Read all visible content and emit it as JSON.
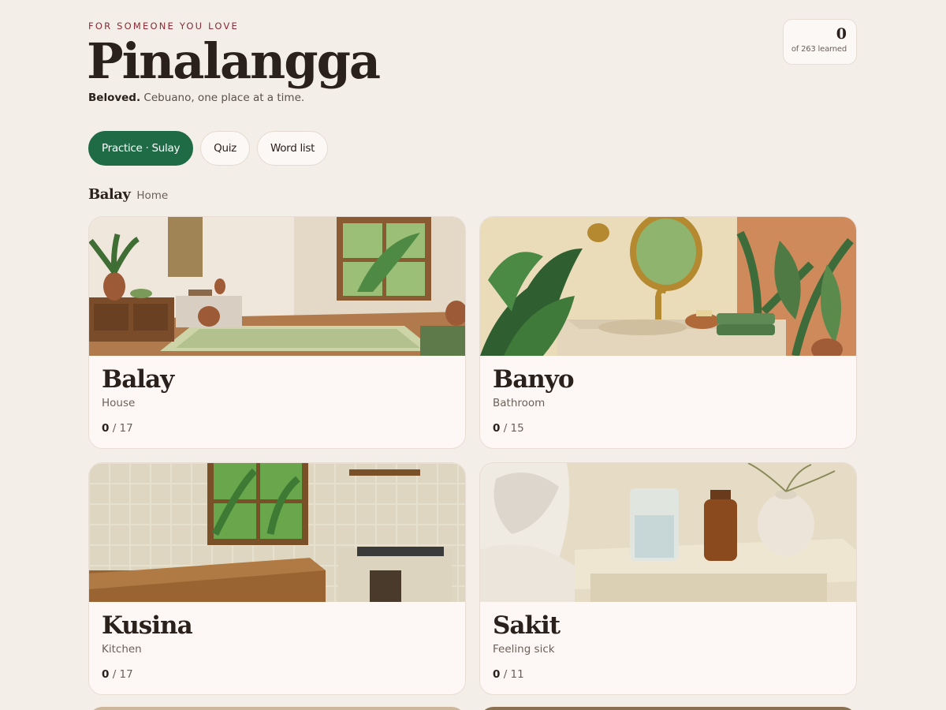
{
  "header": {
    "eyebrow": "FOR SOMEONE YOU LOVE",
    "title": "Pinalangga",
    "tagline_bold": "Beloved.",
    "tagline_rest": " Cebuano, one place at a time."
  },
  "progress": {
    "count": "0",
    "label": "of 263 learned"
  },
  "tabs": [
    {
      "label": "Practice · Sulay",
      "active": true
    },
    {
      "label": "Quiz",
      "active": false
    },
    {
      "label": "Word list",
      "active": false
    }
  ],
  "section": {
    "title": "Balay",
    "subtitle": "Home"
  },
  "cards": [
    {
      "name": "Balay",
      "english": "House",
      "learned": "0",
      "total": "/ 17",
      "scene": "living-room"
    },
    {
      "name": "Banyo",
      "english": "Bathroom",
      "learned": "0",
      "total": "/ 15",
      "scene": "bathroom"
    },
    {
      "name": "Kusina",
      "english": "Kitchen",
      "learned": "0",
      "total": "/ 17",
      "scene": "kitchen"
    },
    {
      "name": "Sakit",
      "english": "Feeling sick",
      "learned": "0",
      "total": "/ 11",
      "scene": "bedside"
    }
  ],
  "colors": {
    "background": "#f4eee8",
    "accent_green": "#1e6b45",
    "eyebrow_red": "#8a2a36",
    "card": "#fdf8f5"
  }
}
